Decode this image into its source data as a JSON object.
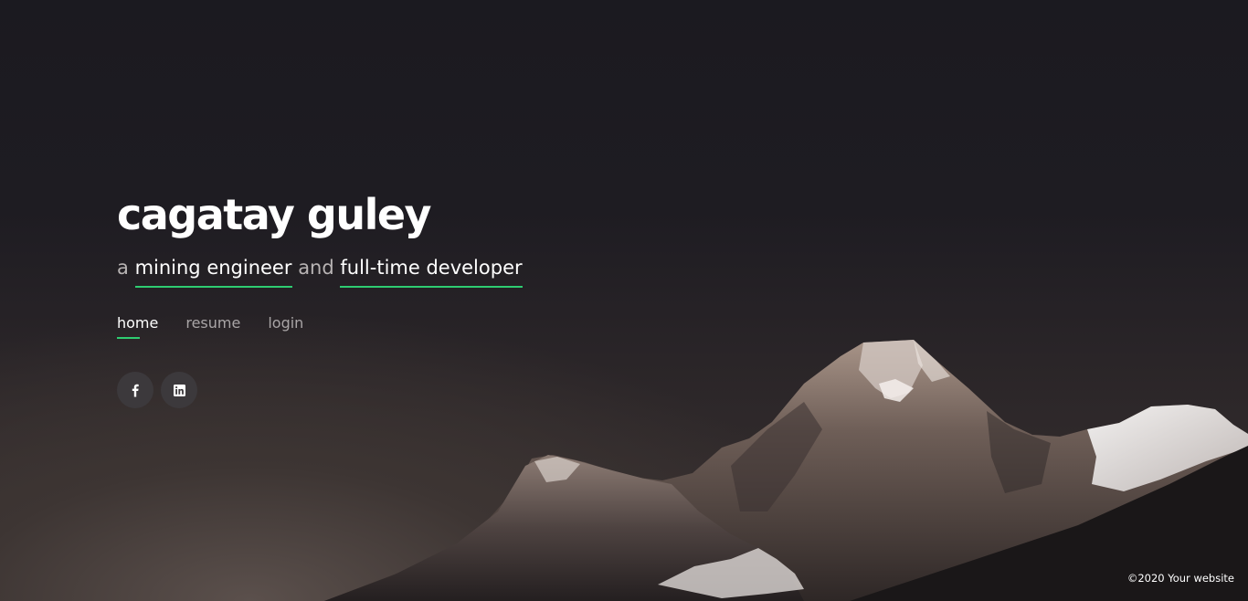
{
  "hero": {
    "name": "cagatay guley",
    "tagline": {
      "prefix": "a",
      "role1": "mining engineer",
      "conj": "and",
      "role2": "full-time developer"
    }
  },
  "nav": {
    "items": [
      {
        "label": "home",
        "active": true
      },
      {
        "label": "resume",
        "active": false
      },
      {
        "label": "login",
        "active": false
      }
    ]
  },
  "social": [
    {
      "icon": "facebook-icon",
      "glyph": "f"
    },
    {
      "icon": "linkedin-icon",
      "glyph": "in"
    }
  ],
  "footer": {
    "copyright": "©2020 Your website"
  },
  "colors": {
    "accent": "#2ecc71",
    "background": "#1e1c22",
    "social_bg": "#3c393c"
  }
}
